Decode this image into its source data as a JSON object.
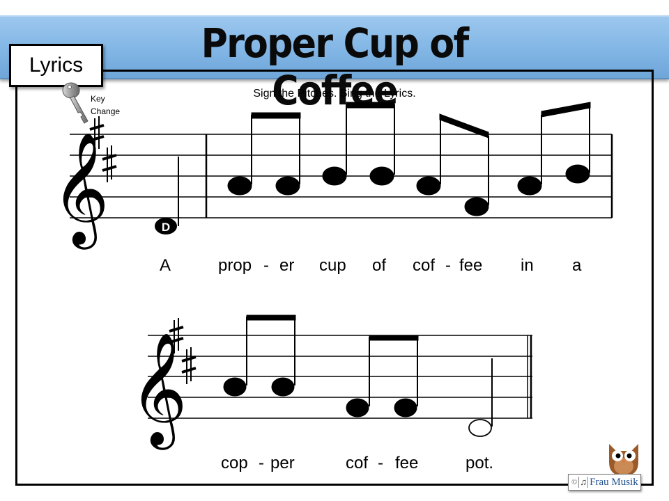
{
  "header": {
    "title": "Proper Cup of Coffee",
    "section_label": "Lyrics"
  },
  "instruction": "Sign the Pitches. Sing the Lyrics.",
  "key_change": {
    "icon": "key-icon",
    "line1": "Key",
    "line2": "Change"
  },
  "staff1": {
    "clef": "treble",
    "key_signature": [
      "F#",
      "C#"
    ],
    "pickup_note_label": "D",
    "lyrics": [
      "A",
      "prop",
      "-",
      "er",
      "cup",
      "of",
      "cof",
      "-",
      "fee",
      "in",
      "a"
    ]
  },
  "staff2": {
    "clef": "treble",
    "key_signature": [
      "F#",
      "C#"
    ],
    "lyrics": [
      "cop",
      "-",
      "per",
      "cof",
      "-",
      "fee",
      "pot."
    ]
  },
  "footer": {
    "copyright": "©",
    "note_glyph": "♫",
    "brand": "Frau Musik",
    "mascot": "owl-icon"
  },
  "colors": {
    "banner": "#7fb4e4",
    "brand_text": "#1f4e8c"
  }
}
